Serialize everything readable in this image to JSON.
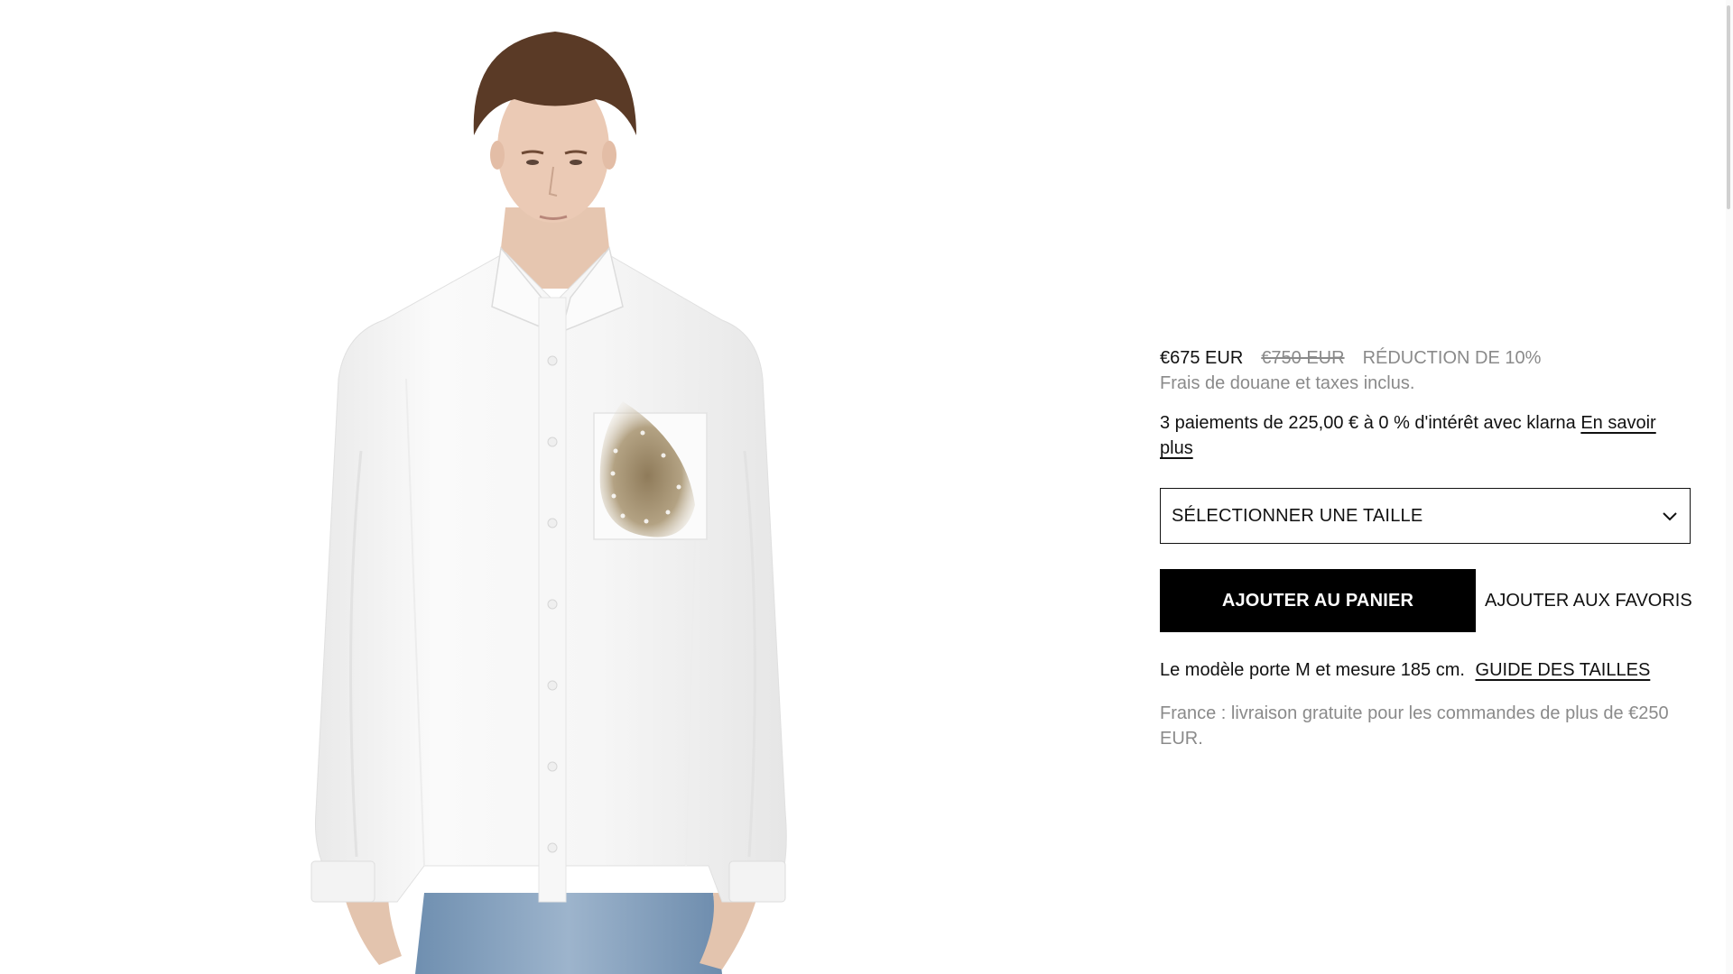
{
  "product": {
    "image_alt": "White shirt with feather print pocket",
    "price_current": "€675 EUR",
    "price_original": "€750 EUR",
    "discount": "RÉDUCTION DE 10%",
    "tax_note": "Frais de douane et taxes inclus.",
    "installments_text": "3 paiements de 225,00 € à 0 % d'intérêt avec klarna",
    "installments_link": "En savoir plus",
    "size_select": "SÉLECTIONNER UNE TAILLE",
    "add_to_cart": "AJOUTER AU PANIER",
    "add_to_favorites": "AJOUTER AUX FAVORIS",
    "model_note": "Le modèle porte M et mesure 185 cm.",
    "size_guide": "GUIDE DES TAILLES",
    "shipping": "France : livraison gratuite pour les commandes de plus de €250 EUR."
  },
  "icons": {
    "size_chevron": "chevron-down-icon"
  },
  "colors": {
    "button_bg": "#000000",
    "muted_text": "#8a8a8a",
    "text": "#111111"
  }
}
